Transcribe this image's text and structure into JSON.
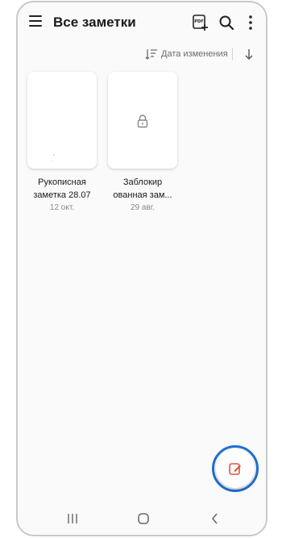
{
  "header": {
    "title": "Все заметки",
    "icons": [
      "menu-icon",
      "pdf-add-icon",
      "search-icon",
      "more-vertical-icon"
    ]
  },
  "sort": {
    "label": "Дата изменения",
    "icon": "sort-lines-icon",
    "direction_icon": "arrow-down-icon"
  },
  "notes": [
    {
      "title_line1": "Рукописная",
      "title_line2": "заметка 28.07",
      "date": "12 окт.",
      "locked": false
    },
    {
      "title_line1": "Заблокир",
      "title_line2": "ованная зам...",
      "date": "29 авг.",
      "locked": true
    }
  ],
  "fab": {
    "icon": "compose-icon",
    "color": "#e0533f",
    "highlight_color": "#1f6fd1"
  },
  "navbar": {
    "icons": [
      "recents-icon",
      "home-icon",
      "back-icon"
    ]
  }
}
